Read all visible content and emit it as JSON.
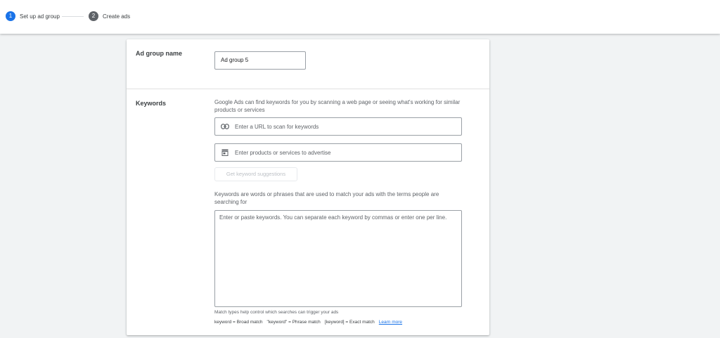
{
  "stepper": {
    "steps": [
      {
        "number": "1",
        "label": "Set up ad group"
      },
      {
        "number": "2",
        "label": "Create ads"
      }
    ]
  },
  "ad_group": {
    "title": "Ad group name",
    "name_value": "Ad group 5"
  },
  "keywords": {
    "title": "Keywords",
    "description": "Google Ads can find keywords for you by scanning a web page or seeing what's working for similar products or services",
    "url_placeholder": "Enter a URL to scan for keywords",
    "url_icon": "link-icon",
    "products_placeholder": "Enter products or services to advertise",
    "products_icon": "store-icon",
    "suggest_button": "Get keyword suggestions",
    "explain": "Keywords are words or phrases that are used to match your ads with the terms people are searching for",
    "textarea_placeholder": "Enter or paste keywords. You can separate each keyword by commas or enter one per line.",
    "match_hint": "Match types help control which searches can trigger your ads",
    "match_broad": "keyword = Broad match",
    "match_phrase": "\"keyword\" = Phrase match",
    "match_exact": "[keyword] = Exact match",
    "learn_more": "Learn more"
  },
  "colors": {
    "accent": "#1a73e8",
    "inactive_step": "#5f6368",
    "background": "#f1f3f4"
  }
}
